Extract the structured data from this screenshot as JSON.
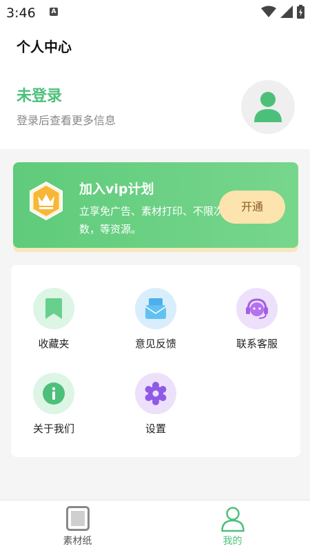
{
  "status_bar": {
    "time": "3:46",
    "notification_letter": "A"
  },
  "header": {
    "title": "个人中心",
    "user_name": "未登录",
    "user_subtitle": "登录后查看更多信息"
  },
  "vip": {
    "title": "加入vip计划",
    "description": "立享免广告、素材打印、不限次数，等资源。",
    "button_label": "开通"
  },
  "menu": [
    {
      "label": "收藏夹",
      "icon": "bookmark-icon"
    },
    {
      "label": "意见反馈",
      "icon": "envelope-icon"
    },
    {
      "label": "联系客服",
      "icon": "headset-icon"
    },
    {
      "label": "关于我们",
      "icon": "info-icon"
    },
    {
      "label": "设置",
      "icon": "gear-icon"
    }
  ],
  "bottom_nav": [
    {
      "label": "素材纸",
      "icon": "paper-icon",
      "active": false
    },
    {
      "label": "我的",
      "icon": "user-icon",
      "active": true
    }
  ],
  "colors": {
    "accent": "#4cc07a",
    "vip_button_bg": "#fde3ad",
    "vip_button_text": "#8a5a24",
    "nav_active": "#4cc07a",
    "nav_inactive": "#555555"
  }
}
